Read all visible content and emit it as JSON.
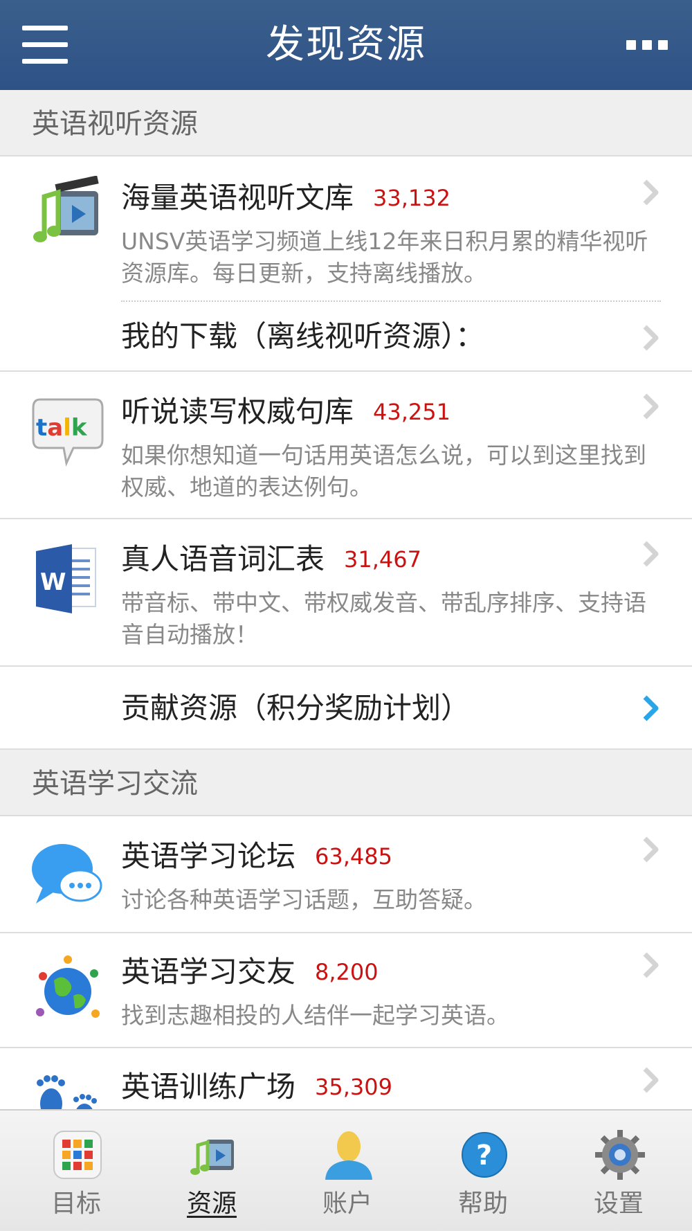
{
  "header": {
    "title": "发现资源"
  },
  "sections": [
    {
      "title": "英语视听资源"
    },
    {
      "title": "英语学习交流"
    }
  ],
  "items": [
    {
      "title": "海量英语视听文库",
      "count": "33,132",
      "desc": "UNSV英语学习频道上线12年来日积月累的精华视听资源库。每日更新，支持离线播放。",
      "icon": "music-video-icon"
    },
    {
      "title": "我的下载（离线视听资源）："
    },
    {
      "title": "听说读写权威句库",
      "count": "43,251",
      "desc": "如果你想知道一句话用英语怎么说，可以到这里找到权威、地道的表达例句。",
      "icon": "talk-bubble-icon"
    },
    {
      "title": "真人语音词汇表",
      "count": "31,467",
      "desc": "带音标、带中文、带权威发音、带乱序排序、支持语音自动播放！",
      "icon": "word-document-icon"
    },
    {
      "title": "贡献资源（积分奖励计划）"
    },
    {
      "title": "英语学习论坛",
      "count": "63,485",
      "desc": "讨论各种英语学习话题，互助答疑。",
      "icon": "chat-bubbles-icon"
    },
    {
      "title": "英语学习交友",
      "count": "8,200",
      "desc": "找到志趣相投的人结伴一起学习英语。",
      "icon": "globe-people-icon"
    },
    {
      "title": "英语训练广场",
      "count": "35,309",
      "icon": "footprints-icon"
    }
  ],
  "tabs": [
    {
      "label": "目标",
      "icon": "apps-grid-icon"
    },
    {
      "label": "资源",
      "icon": "music-video-icon",
      "active": true
    },
    {
      "label": "账户",
      "icon": "user-icon"
    },
    {
      "label": "帮助",
      "icon": "help-icon"
    },
    {
      "label": "设置",
      "icon": "gear-icon"
    }
  ],
  "colors": {
    "header": "#2e5286",
    "count": "#cc1111",
    "accent_chevron": "#2aa6e8"
  }
}
